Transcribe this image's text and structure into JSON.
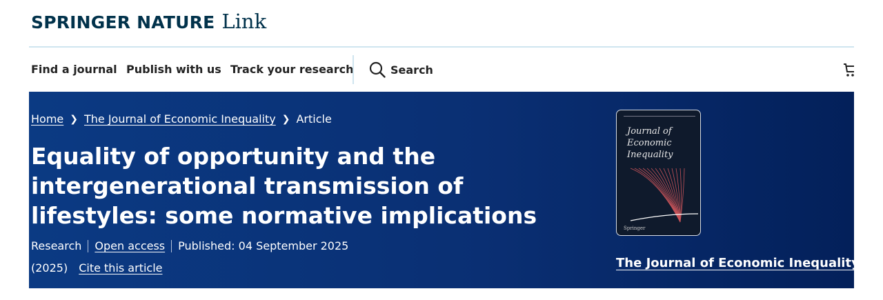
{
  "logo": {
    "brand": "SPRINGER NATURE",
    "sub": "Link"
  },
  "nav": {
    "items": [
      {
        "label": "Find a journal"
      },
      {
        "label": "Publish with us"
      },
      {
        "label": "Track your research"
      }
    ],
    "search_label": "Search"
  },
  "breadcrumb": {
    "home": "Home",
    "journal": "The Journal of Economic Inequality",
    "current": "Article"
  },
  "article": {
    "title": "Equality of opportunity and the intergenerational transmission of lifestyles: some normative implications",
    "type": "Research",
    "access": "Open access",
    "published": "Published: 04 September 2025",
    "year": "(2025)",
    "cite": "Cite this article"
  },
  "journal": {
    "cover_title_line1": "Journal of",
    "cover_title_line2": "Economic Inequality",
    "cover_publisher": "Springer",
    "name": "The Journal of Economic Inequality"
  },
  "icons": {
    "search": "search-icon",
    "cart": "cart-icon"
  },
  "colors": {
    "brand": "#01324b",
    "hero": "#0a2f73",
    "divider": "#cfe5ef"
  }
}
